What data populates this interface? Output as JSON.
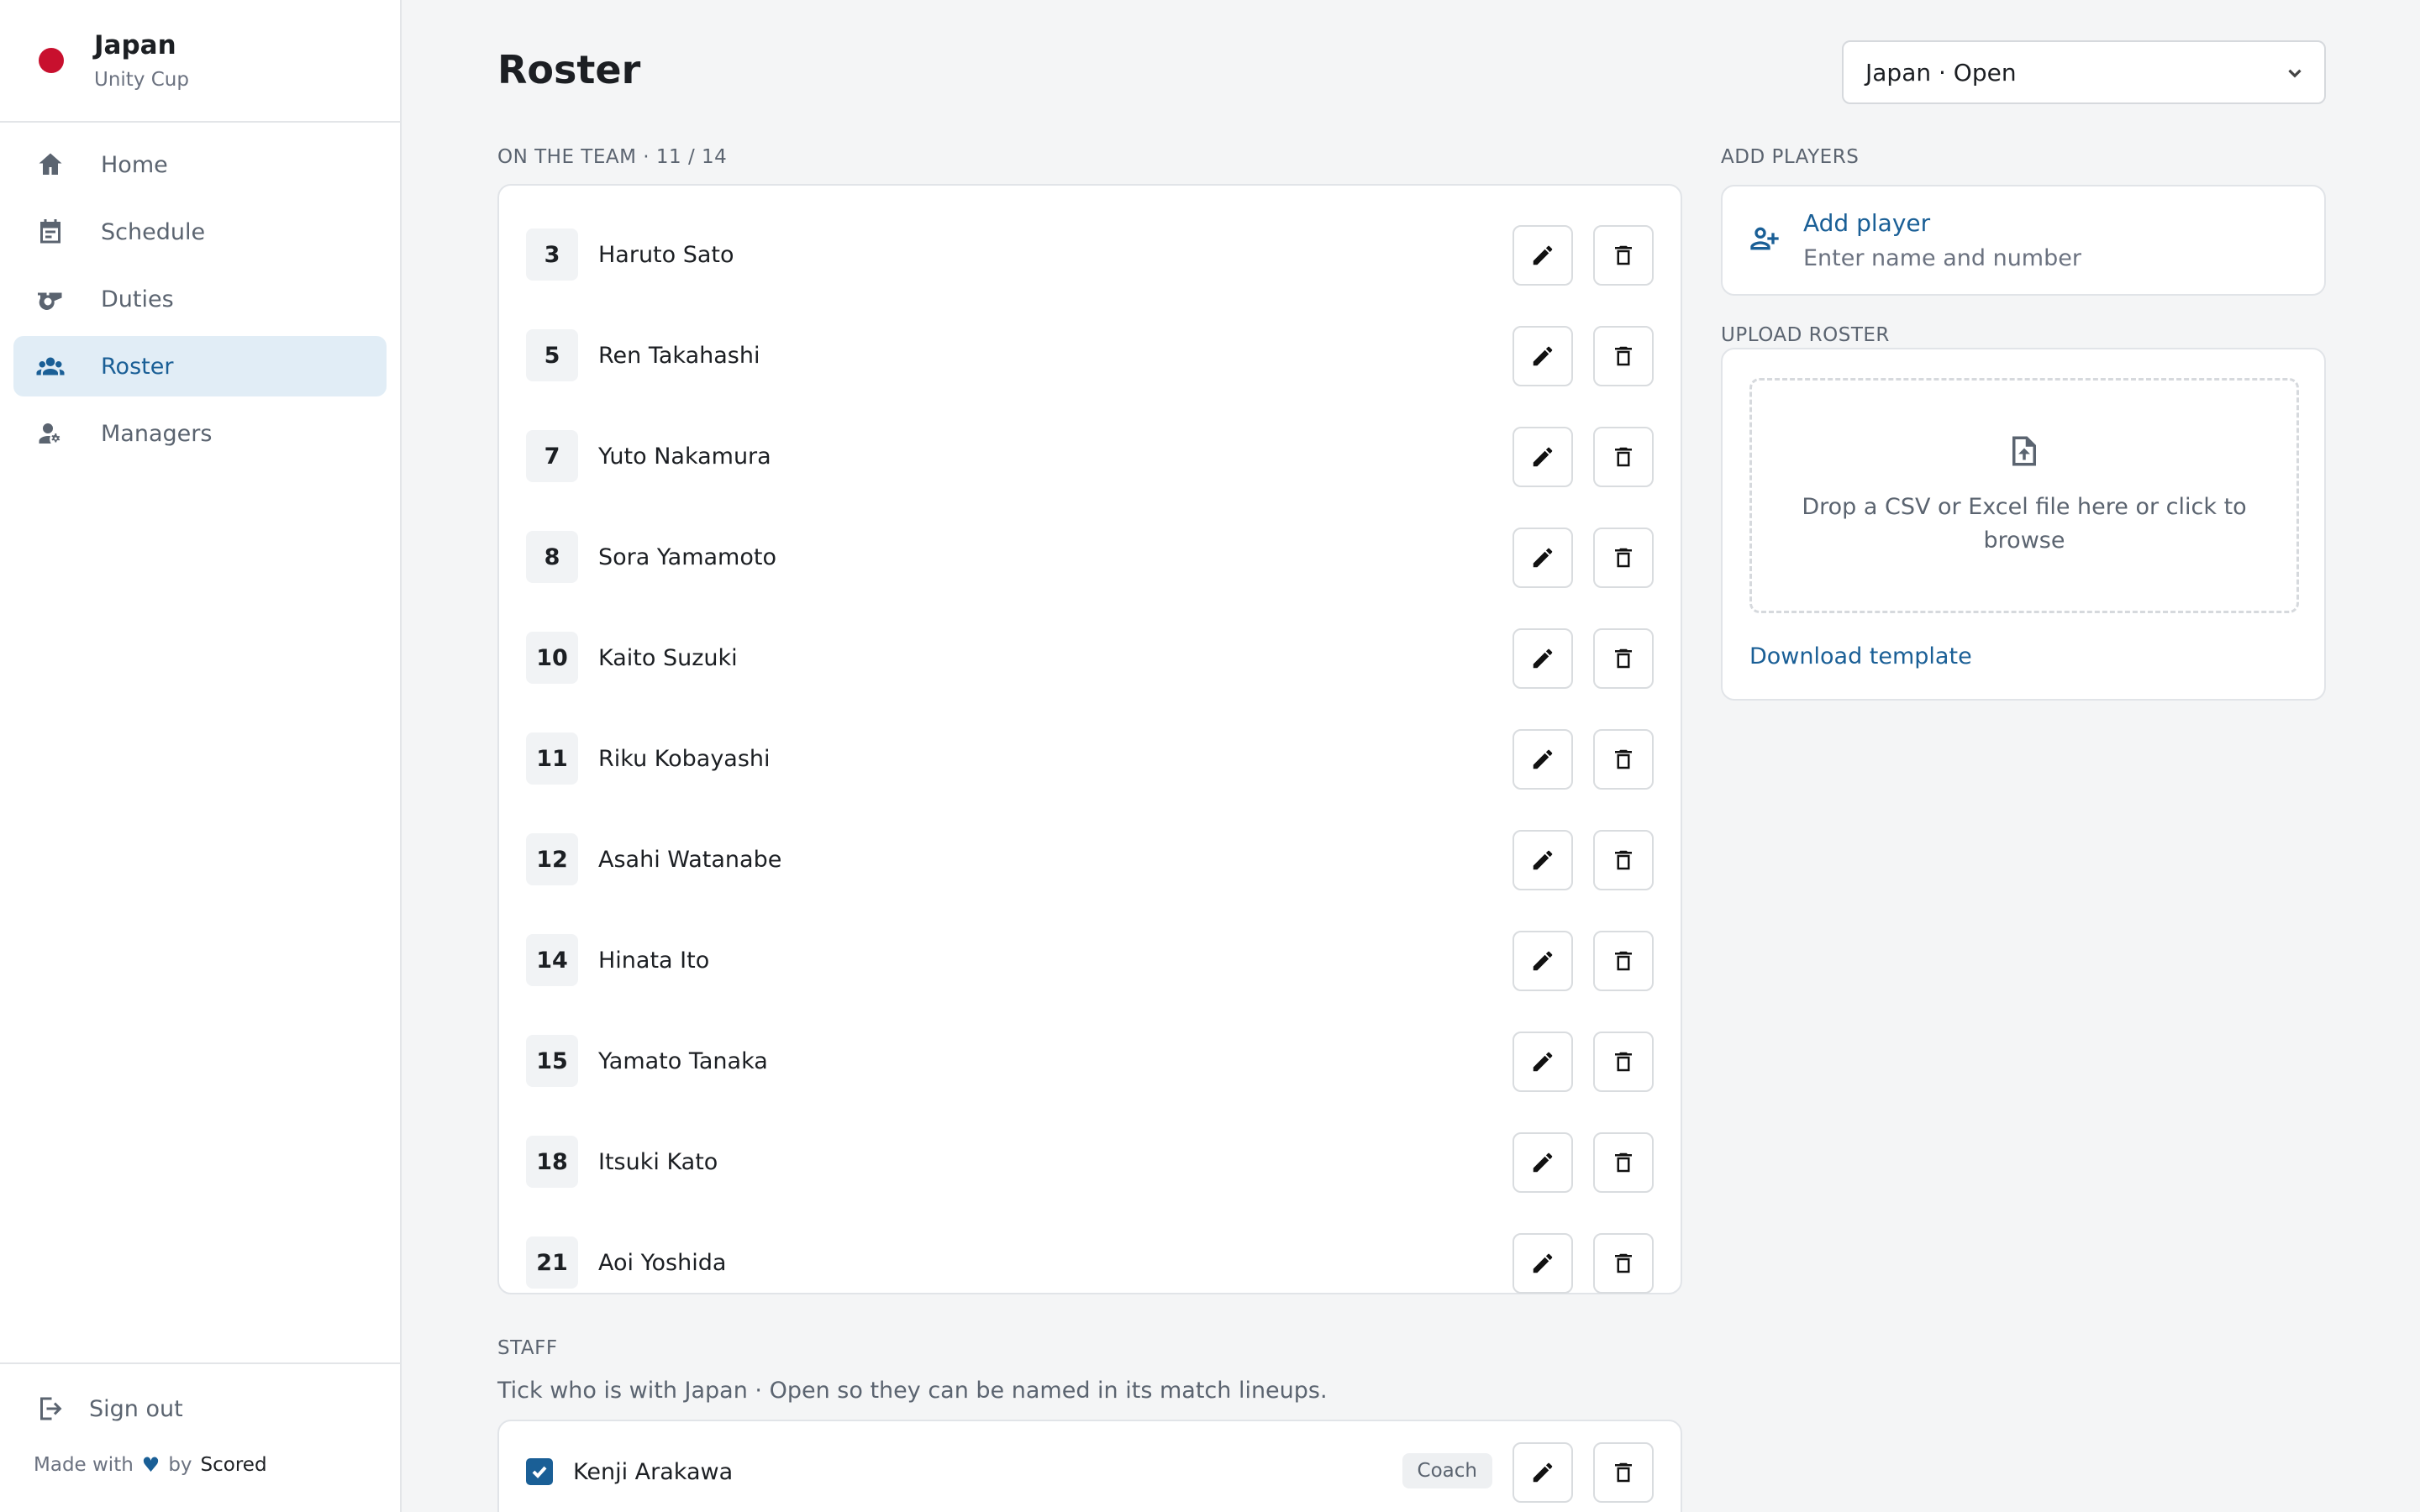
{
  "team": {
    "name": "Japan",
    "competition": "Unity Cup",
    "flag_color": "#c8102e"
  },
  "nav": {
    "home": "Home",
    "schedule": "Schedule",
    "duties": "Duties",
    "roster": "Roster",
    "managers": "Managers",
    "active": "Roster"
  },
  "footer": {
    "signout": "Sign out",
    "made_with": "Made with",
    "by": "by",
    "brand": "Scored"
  },
  "page": {
    "title": "Roster",
    "team_select": "Japan · Open"
  },
  "team_section": {
    "label": "ON THE TEAM · 11 / 14",
    "players": [
      {
        "number": "3",
        "name": "Haruto Sato"
      },
      {
        "number": "5",
        "name": "Ren Takahashi"
      },
      {
        "number": "7",
        "name": "Yuto Nakamura"
      },
      {
        "number": "8",
        "name": "Sora Yamamoto"
      },
      {
        "number": "10",
        "name": "Kaito Suzuki"
      },
      {
        "number": "11",
        "name": "Riku Kobayashi"
      },
      {
        "number": "12",
        "name": "Asahi Watanabe"
      },
      {
        "number": "14",
        "name": "Hinata Ito"
      },
      {
        "number": "15",
        "name": "Yamato Tanaka"
      },
      {
        "number": "18",
        "name": "Itsuki Kato"
      },
      {
        "number": "21",
        "name": "Aoi Yoshida"
      }
    ]
  },
  "add_players": {
    "label": "ADD PLAYERS",
    "title": "Add player",
    "subtitle": "Enter name and number"
  },
  "upload": {
    "label": "UPLOAD ROSTER",
    "drop_text": "Drop a CSV or Excel file here or click to browse",
    "template_link": "Download template"
  },
  "staff": {
    "label": "STAFF",
    "help": "Tick who is with Japan · Open so they can be named in its match lineups.",
    "members": [
      {
        "name": "Kenji Arakawa",
        "role": "Coach",
        "checked": true
      }
    ]
  },
  "colors": {
    "accent": "#1a5f96",
    "active_bg": "#e1edf6",
    "background": "#f4f5f6"
  }
}
